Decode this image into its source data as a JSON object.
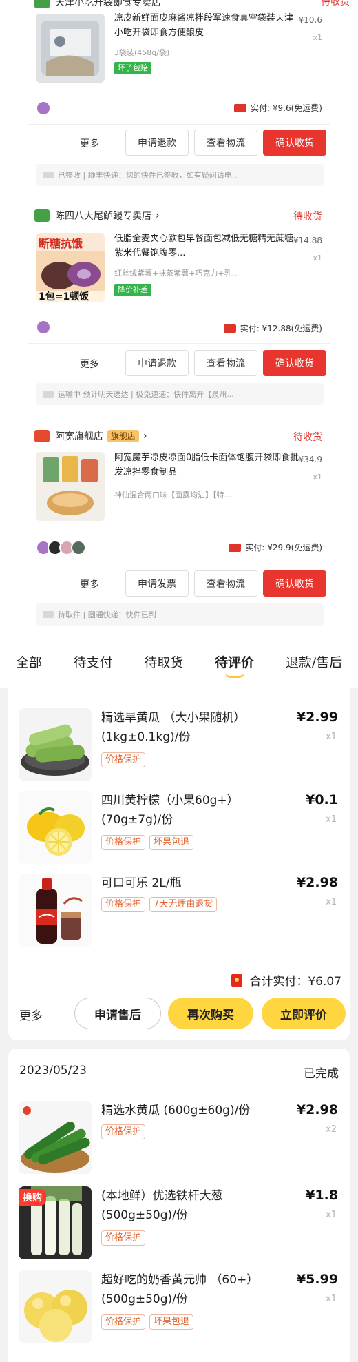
{
  "upper": {
    "order1": {
      "shop_name": "天津小吃开袋即食专卖店",
      "status": "待收货",
      "title": "凉皮新鲜面皮麻酱凉拌段军速食真空袋装天津小吃开袋即食方便酿皮",
      "sku": "3袋装(458g/袋)",
      "tag": "坏了包赔",
      "price": "¥10.6",
      "qty": "x1",
      "paid": "实付: ¥9.6(免运费)",
      "more": "更多",
      "btn1": "申请退款",
      "btn2": "查看物流",
      "btn3": "确认收货",
      "logistics": "已签收 | 顺丰快递：您的快件已签收，如有疑问请电..."
    },
    "order2": {
      "shop_name": "陈四八大尾鲈鳗专卖店",
      "status": "待收货",
      "img_text1": "断糖抗饿",
      "img_text2": "1包=1顿饭",
      "title": "低脂全麦夹心欧包早餐面包减低无糖精无蔗糖紫米代餐饱腹零...",
      "sku": "红丝绒紫薯+抹茶紫薯+巧克力+乳...",
      "tag": "降价补差",
      "price": "¥14.88",
      "qty": "x1",
      "paid": "实付: ¥12.88(免运费)",
      "more": "更多",
      "btn1": "申请退款",
      "btn2": "查看物流",
      "btn3": "确认收货",
      "logistics": "运输中 预计明天送达 | 极兔速递：快件离开【泉州..."
    },
    "order3": {
      "shop_name": "阿宽旗舰店",
      "shop_badge": "旗舰店",
      "status": "待收货",
      "title": "阿宽魔芋凉皮凉面0脂低卡面体饱腹开袋即食批发凉拌零食制品",
      "sku": "神仙混合两口味【面露均沾】【特...",
      "price": "¥34.9",
      "qty": "x1",
      "paid": "实付: ¥29.9(免运费)",
      "more": "更多",
      "btn1": "申请发票",
      "btn2": "查看物流",
      "btn3": "确认收货",
      "logistics": "待取件 | 圆通快递：快件已到"
    }
  },
  "tabs": [
    {
      "label": "全部"
    },
    {
      "label": "待支付"
    },
    {
      "label": "待取货"
    },
    {
      "label": "待评价"
    },
    {
      "label": "退款/售后"
    }
  ],
  "active_tab": "待评价",
  "order_a": {
    "items": [
      {
        "title": "精选旱黄瓜 （大小果随机）(1kg±0.1kg)/份",
        "price": "¥2.99",
        "qty": "x1",
        "tags": [
          "价格保护"
        ]
      },
      {
        "title": "四川黄柠檬（小果60g+）(70g±7g)/份",
        "price": "¥0.1",
        "qty": "x1",
        "tags": [
          "价格保护",
          "坏果包退"
        ]
      },
      {
        "title": "可口可乐 2L/瓶",
        "price": "¥2.98",
        "qty": "x1",
        "tags": [
          "价格保护",
          "7天无理由退货"
        ]
      }
    ],
    "total": "合计实付：¥6.07",
    "more": "更多",
    "btn_after_sale": "申请售后",
    "btn_rebuy": "再次购买",
    "btn_review": "立即评价"
  },
  "order_b": {
    "date": "2023/05/23",
    "status": "已完成",
    "swap_badge": "换购",
    "items": [
      {
        "title": "精选水黄瓜 (600g±60g)/份",
        "price": "¥2.98",
        "qty": "x2",
        "tags": [
          "价格保护"
        ]
      },
      {
        "title": "(本地鲜）优选铁杆大葱 (500g±50g)/份",
        "price": "¥1.8",
        "qty": "x1",
        "tags": [
          "价格保护"
        ]
      },
      {
        "title": "超好吃的奶香黄元帅 （60+）(500g±50g)/份",
        "price": "¥5.99",
        "qty": "x1",
        "tags": [
          "价格保护",
          "坏果包退"
        ]
      }
    ]
  }
}
